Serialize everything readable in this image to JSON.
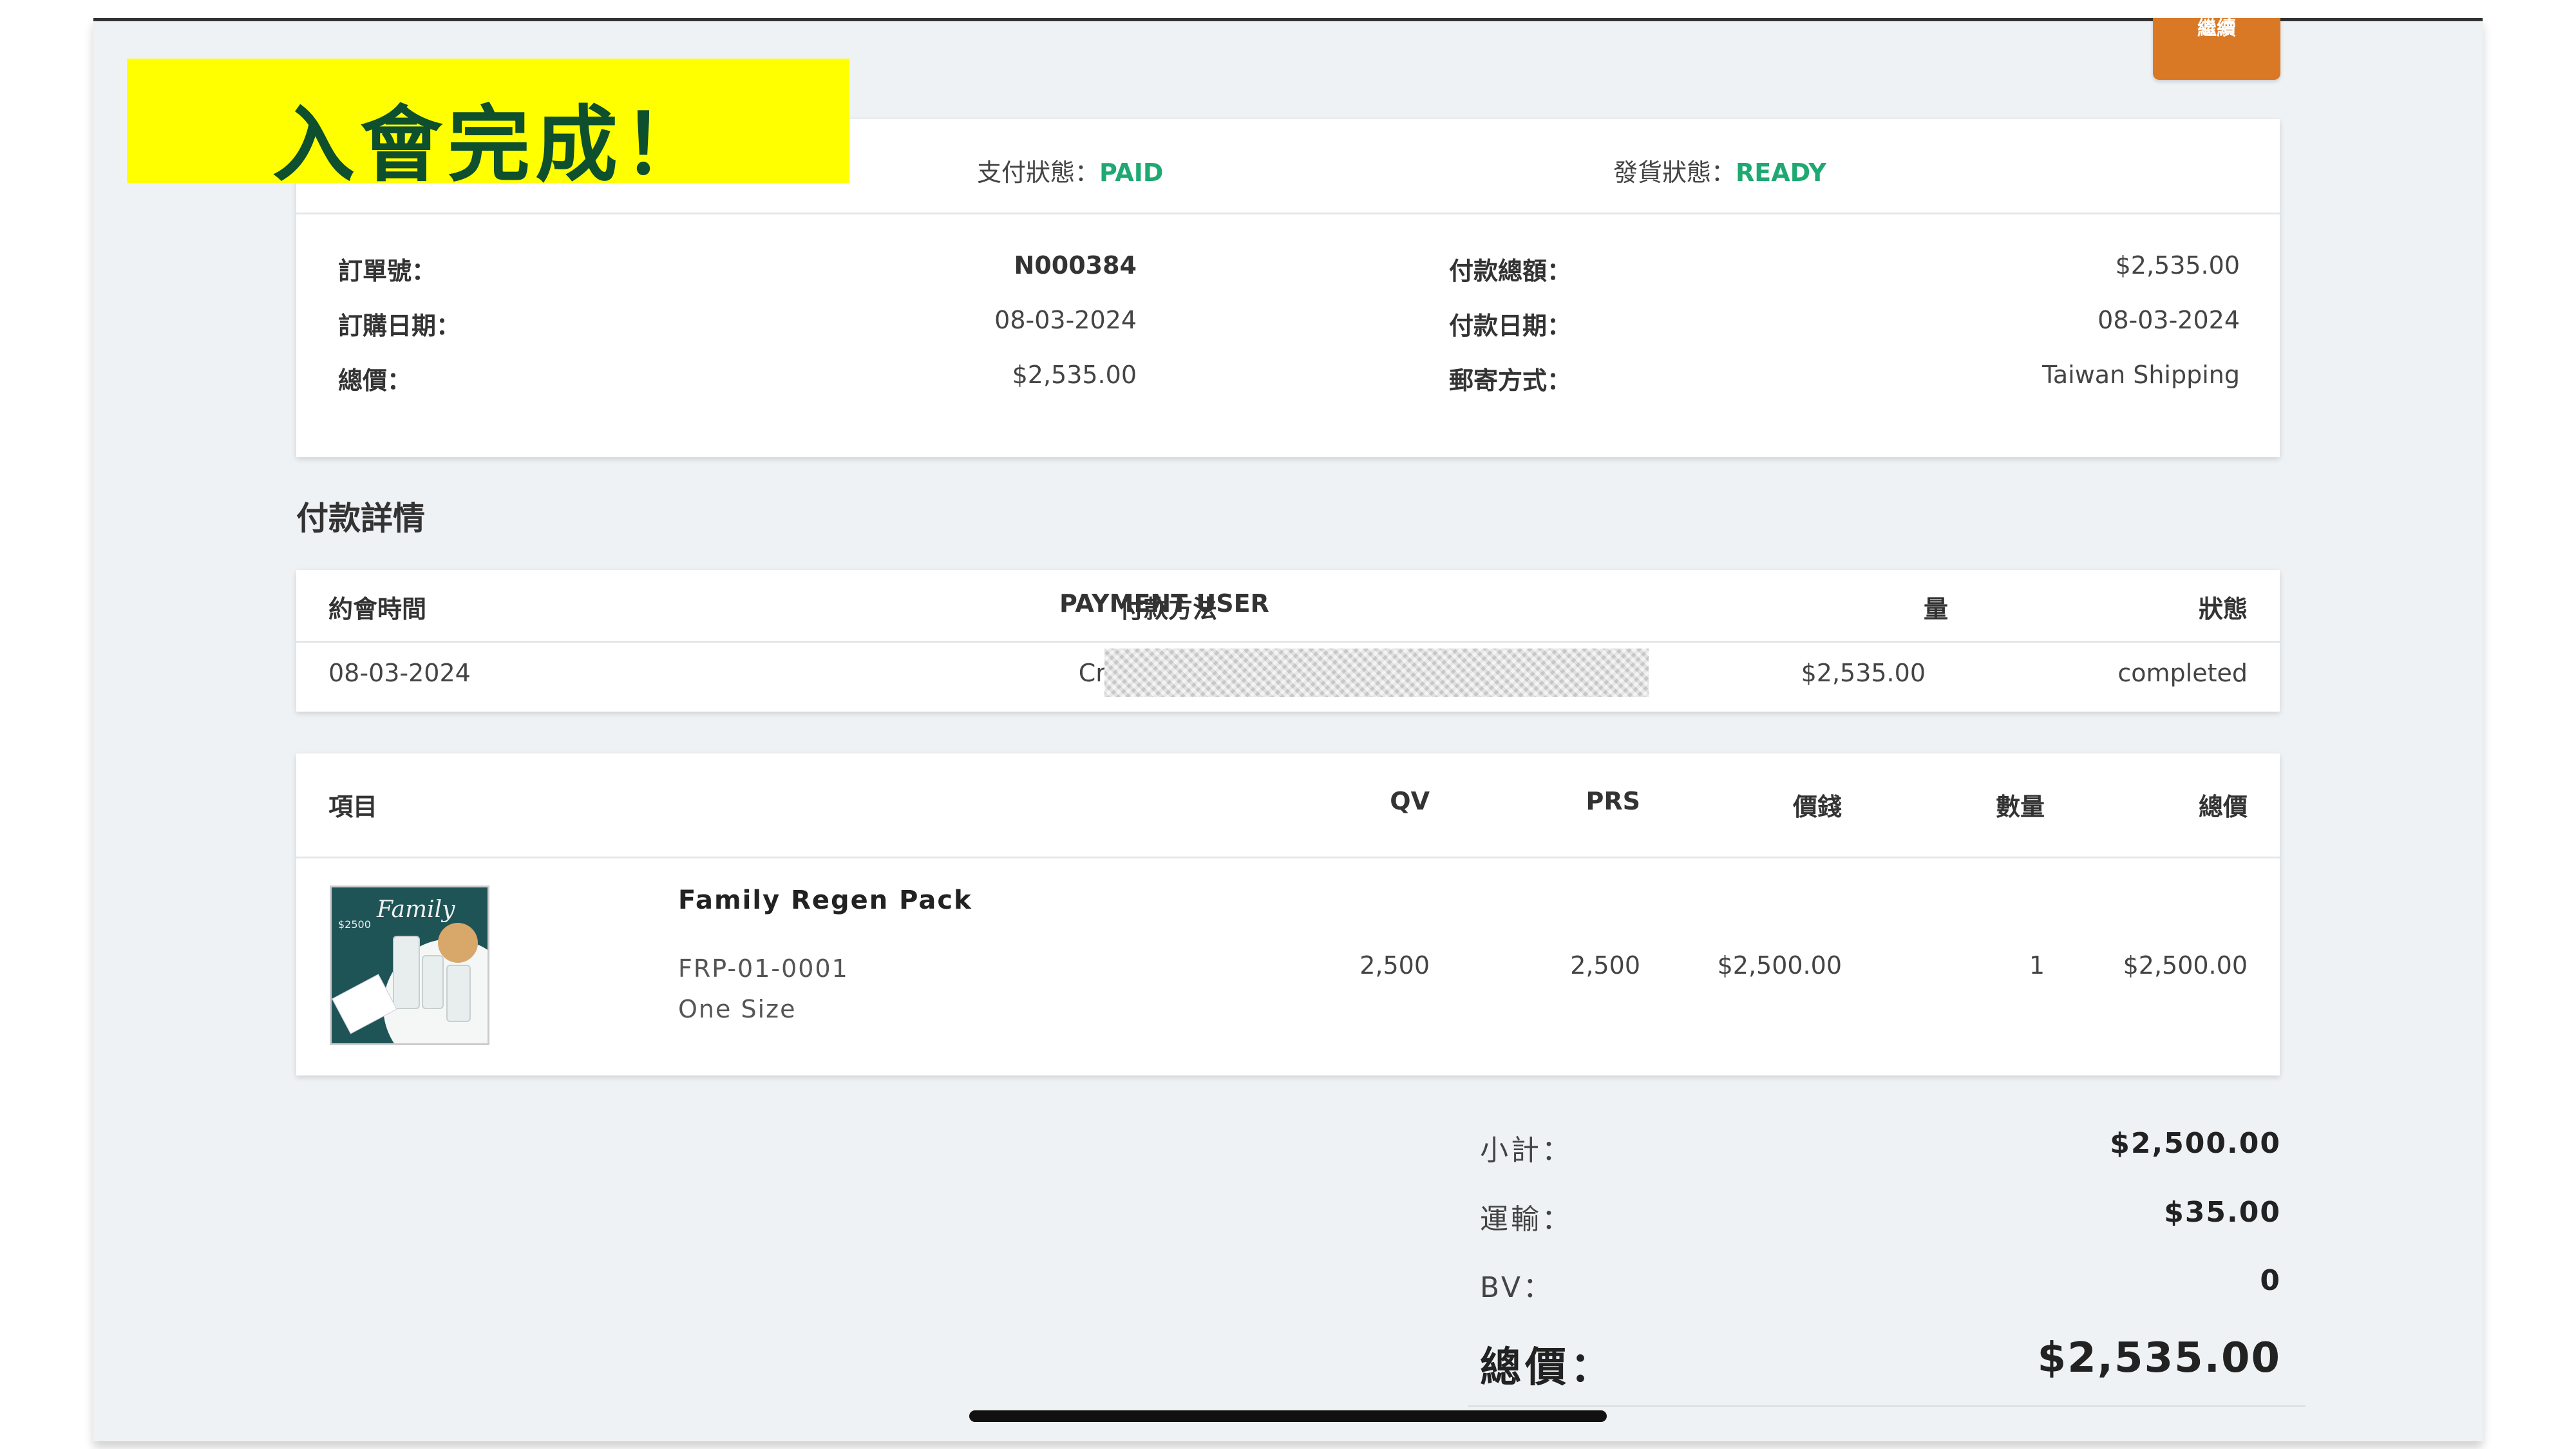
{
  "overlay": {
    "banner_text": "入會完成！",
    "top_button_label": "繼續"
  },
  "order_status": {
    "payment_status_label": "支付狀態：",
    "payment_status_value": "PAID",
    "shipping_status_label": "發貨狀態：",
    "shipping_status_value": "READY"
  },
  "order_info": {
    "order_no_label": "訂單號：",
    "order_no_value": "N000384",
    "order_date_label": "訂購日期：",
    "order_date_value": "08-03-2024",
    "total_label": "總價：",
    "total_value": "$2,535.00",
    "payment_total_label": "付款總額：",
    "payment_total_value": "$2,535.00",
    "payment_date_label": "付款日期：",
    "payment_date_value": "08-03-2024",
    "shipping_method_label": "郵寄方式：",
    "shipping_method_value": "Taiwan Shipping"
  },
  "payment_details": {
    "title": "付款詳情",
    "headers": [
      "約會時間",
      "付款方法",
      "PAYMENT USER",
      "量",
      "狀態"
    ],
    "row": {
      "date": "08-03-2024",
      "method": "Credit Card",
      "amount": "$2,535.00",
      "status": "completed"
    }
  },
  "items": {
    "headers": [
      "項目",
      "QV",
      "PRS",
      "價錢",
      "數量",
      "總價"
    ],
    "rows": [
      {
        "name": "Family Regen Pack",
        "sku": "FRP-01-0001",
        "size": "One Size",
        "qv": "2,500",
        "prs": "2,500",
        "price": "$2,500.00",
        "qty": "1",
        "total": "$2,500.00",
        "thumb_script": "Family",
        "thumb_price": "$2500"
      }
    ]
  },
  "summary": {
    "subtotal_label": "小計：",
    "subtotal_value": "$2,500.00",
    "shipping_label": "運輸：",
    "shipping_value": "$35.00",
    "bv_label": "BV：",
    "bv_value": "0",
    "grand_total_label": "總價：",
    "grand_total_value": "$2,535.00"
  },
  "colors": {
    "accent_green": "#1fa972",
    "banner_yellow": "#ffff00",
    "button_orange": "#d97925"
  }
}
